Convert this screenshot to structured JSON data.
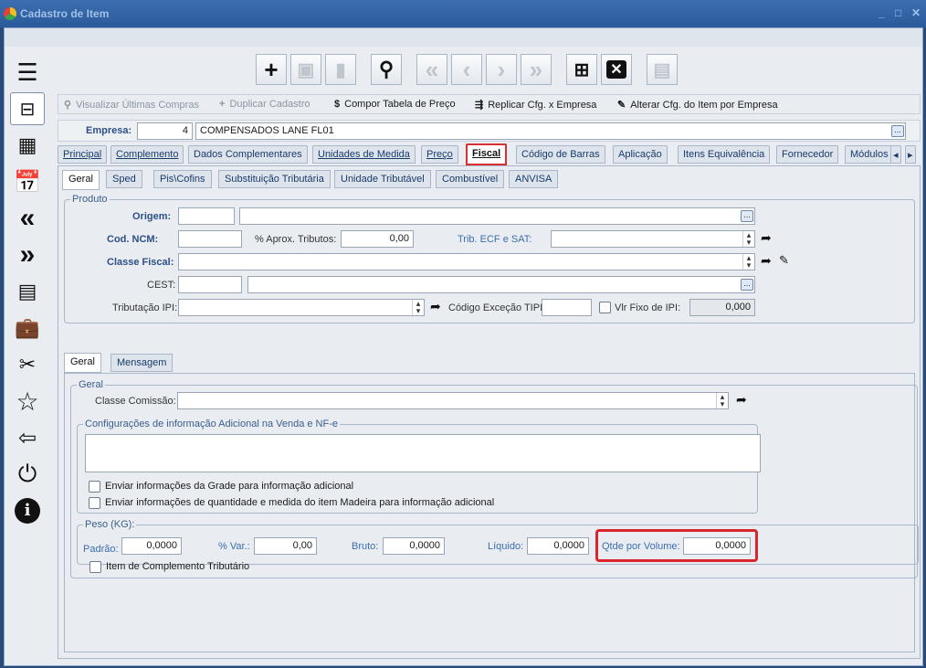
{
  "window": {
    "title": "Cadastro de Item",
    "min": "_",
    "max": "□",
    "close": "✕"
  },
  "sidebar": {
    "icons": [
      "menu-icon",
      "layout-icon",
      "building-icon",
      "calendar-icon",
      "double-left-icon",
      "double-right-icon",
      "calculator-icon",
      "briefcase-icon",
      "tools-icon",
      "star-icon",
      "logout-icon",
      "power-icon",
      "info-icon"
    ]
  },
  "toolbar": {
    "icons": [
      "add-icon",
      "save-icon",
      "delete-icon",
      "search-icon",
      "first-icon",
      "prev-icon",
      "next-icon",
      "last-icon",
      "grid-icon",
      "clear-icon",
      "report-icon"
    ]
  },
  "actions": {
    "ultimas": "Visualizar Últimas Compras",
    "duplicar": "Duplicar Cadastro",
    "compor": "Compor Tabela de Preço",
    "replicar": "Replicar Cfg. x Empresa",
    "alterar": "Alterar Cfg. do Item por Empresa"
  },
  "empresa": {
    "label": "Empresa:",
    "code": "4",
    "name": "COMPENSADOS LANE FL01"
  },
  "tabs": [
    "Principal",
    "Complemento",
    "Dados Complementares",
    "Unidades de Medida",
    "Preço",
    "Fiscal",
    "Código de Barras",
    "Aplicação",
    "Itens Equivalência",
    "Fornecedor",
    "Módulos"
  ],
  "subtabs": [
    "Geral",
    "Sped",
    "Pis\\Cofins",
    "Substituição Tributária",
    "Unidade Tributável",
    "Combustível",
    "ANVISA"
  ],
  "produto": {
    "title": "Produto",
    "origem_label": "Origem:",
    "origem_code": "",
    "origem_desc": "",
    "ncm_label": "Cod. NCM:",
    "ncm_value": "",
    "aprox_label": "% Aprox. Tributos:",
    "aprox_value": "0,00",
    "trib_label": "Trib. ECF e SAT:",
    "trib_value": "",
    "classe_label": "Classe Fiscal:",
    "classe_value": "",
    "cest_label": "CEST:",
    "cest_code": "",
    "cest_desc": "",
    "ipi_label": "Tributação IPI:",
    "ipi_value": "",
    "excecao_label": "Código Exceção TIPI:",
    "excecao_value": "",
    "fixo_label": "Vlr Fixo de IPI:",
    "fixo_value": "0,000"
  },
  "innertabs": [
    "Geral",
    "Mensagem"
  ],
  "geral": {
    "title": "Geral",
    "comissao_label": "Classe Comissão:",
    "comissao_value": "",
    "config_title": "Configurações de informação Adicional na Venda e NF-e",
    "config_text": "",
    "chk1": "Enviar informações da Grade para informação adicional",
    "chk2": "Enviar informações de quantidade e medida do item Madeira para informação adicional"
  },
  "peso": {
    "title": "Peso (KG):",
    "padrao_label": "Padrão:",
    "padrao": "0,0000",
    "var_label": "% Var.:",
    "var": "0,00",
    "bruto_label": "Bruto:",
    "bruto": "0,0000",
    "liquido_label": "Líquido:",
    "liquido": "0,0000",
    "qtde_label": "Qtde por Volume:",
    "qtde": "0,0000"
  },
  "complemento_label": "Item de Complemento Tributário"
}
